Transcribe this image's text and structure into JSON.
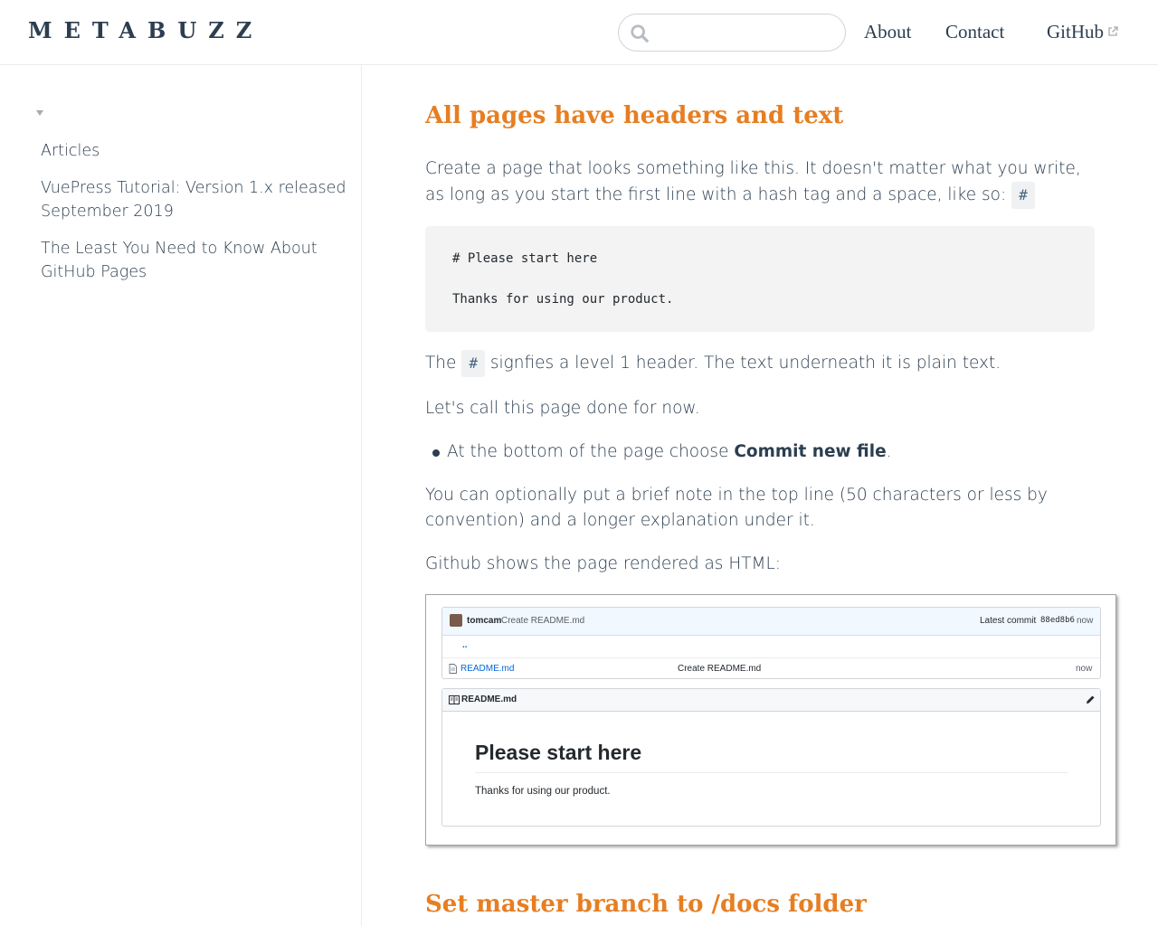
{
  "header": {
    "logo": "METABUZZ",
    "search": {
      "value": "",
      "placeholder": ""
    },
    "nav": {
      "about": "About",
      "contact": "Contact",
      "github": "GitHub"
    }
  },
  "sidebar": {
    "items": [
      {
        "label": "Articles"
      },
      {
        "label": "VuePress Tutorial: Version 1.x released September 2019"
      },
      {
        "label": "The Least You Need to Know About GitHub Pages"
      }
    ]
  },
  "content": {
    "heading1": "All pages have headers and text",
    "p1_text": "Create a page that looks something like this. It doesn't matter what you write, as long as you start the first line with a hash tag and a space, like so:",
    "p1_code": "#",
    "code_block": {
      "line1": "# Please start here",
      "line2": "Thanks for using our product."
    },
    "p2_before": "The",
    "p2_code": "#",
    "p2_after": "signfies a level 1 header. The text underneath it is plain text.",
    "p3": "Let's call this page done for now.",
    "bullet_before": "At the bottom of the page choose",
    "bullet_bold": "Commit new file",
    "bullet_after": ".",
    "p4": "You can optionally put a brief note in the top line (50 characters or less by convention) and a longer explanation under it.",
    "p5": "Github shows the page rendered as HTML:",
    "heading2": "Set master branch to /docs folder"
  },
  "github_screenshot": {
    "commit_user": "tomcam",
    "commit_message": "Create README.md",
    "latest_commit_label": "Latest commit",
    "commit_hash": "88ed8b6",
    "commit_time": "now",
    "parent_dir": "..",
    "file_name": "README.md",
    "file_message": "Create README.md",
    "file_time": "now",
    "readme_title": "README.md",
    "rendered_h1": "Please start here",
    "rendered_p": "Thanks for using our product."
  },
  "icons": {
    "search": "search-icon",
    "external": "external-link-icon",
    "caret": "caret-down-icon",
    "file": "file-icon",
    "book": "book-icon",
    "pencil": "pencil-icon"
  },
  "colors": {
    "heading": "#e67e22",
    "text": "#2c3e50",
    "link": "#0366d6"
  }
}
